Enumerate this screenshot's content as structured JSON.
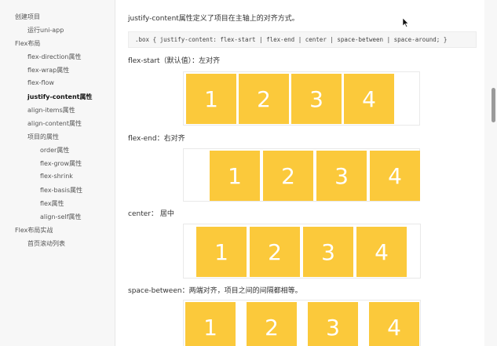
{
  "sidebar": {
    "items": [
      {
        "label": "创建项目"
      },
      {
        "label": "运行uni-app"
      },
      {
        "label": "Flex布局"
      },
      {
        "label": "flex-direction属性"
      },
      {
        "label": "flex-wrap属性"
      },
      {
        "label": "flex-flow"
      },
      {
        "label": "justify-content属性"
      },
      {
        "label": "align-items属性"
      },
      {
        "label": "align-content属性"
      },
      {
        "label": "项目的属性"
      },
      {
        "label": "order属性"
      },
      {
        "label": "flex-grow属性"
      },
      {
        "label": "flex-shrink"
      },
      {
        "label": "flex-basis属性"
      },
      {
        "label": "flex属性"
      },
      {
        "label": "align-self属性"
      },
      {
        "label": "Flex布局实战"
      },
      {
        "label": "首页滚动列表"
      }
    ],
    "active": "justify-content属性"
  },
  "content": {
    "intro": "justify-content属性定义了项目在主轴上的对齐方式。",
    "code": ".box { justify-content: flex-start | flex-end | center | space-between | space-around; }",
    "sections": [
      {
        "label": "flex-start（默认值）：左对齐",
        "items": [
          "1",
          "2",
          "3",
          "4"
        ]
      },
      {
        "label": "flex-end：右对齐",
        "items": [
          "1",
          "2",
          "3",
          "4"
        ]
      },
      {
        "label": "center： 居中",
        "items": [
          "1",
          "2",
          "3",
          "4"
        ]
      },
      {
        "label": "space-between：两端对齐，项目之间的间隔都相等。",
        "items": [
          "1",
          "2",
          "3",
          "4"
        ]
      }
    ]
  },
  "colors": {
    "box": "#fbc93b",
    "box_text": "#ffffff"
  }
}
